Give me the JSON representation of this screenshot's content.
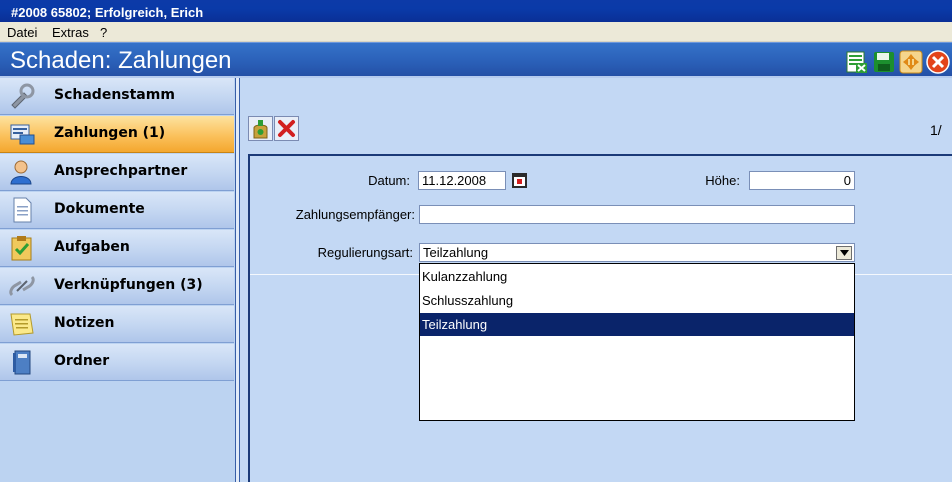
{
  "window": {
    "title": "#2008 65802; Erfolgreich, Erich"
  },
  "menu": {
    "items": [
      {
        "label": "Datei"
      },
      {
        "label": "Extras"
      },
      {
        "label": "?"
      }
    ]
  },
  "header": {
    "title": "Schaden: Zahlungen",
    "buttons": [
      {
        "icon": "excel-export-icon",
        "color": "#2e9e35"
      },
      {
        "icon": "save-icon",
        "color": "#1c8f2e"
      },
      {
        "icon": "navigate-icon",
        "color": "#f2a31b"
      },
      {
        "icon": "close-icon",
        "color": "#e3441a"
      }
    ]
  },
  "sidebar": {
    "items": [
      {
        "label": "Schadenstamm",
        "icon": "wrench-icon",
        "active": false
      },
      {
        "label": "Zahlungen (1)",
        "icon": "payment-icon",
        "active": true
      },
      {
        "label": "Ansprechpartner",
        "icon": "person-icon",
        "active": false
      },
      {
        "label": "Dokumente",
        "icon": "document-icon",
        "active": false
      },
      {
        "label": "Aufgaben",
        "icon": "task-icon",
        "active": false
      },
      {
        "label": "Verknüpfungen (3)",
        "icon": "link-icon",
        "active": false
      },
      {
        "label": "Notizen",
        "icon": "notes-icon",
        "active": false
      },
      {
        "label": "Ordner",
        "icon": "folder-icon",
        "active": false
      }
    ]
  },
  "toolbar": {
    "add_icon": "add-payment-icon",
    "delete_icon": "delete-icon",
    "page_counter": "1/"
  },
  "form": {
    "datum_label": "Datum:",
    "datum_value": "11.12.2008",
    "hoehe_label": "Höhe:",
    "hoehe_value": "0",
    "empfaenger_label": "Zahlungsempfänger:",
    "empfaenger_value": "",
    "regulierungsart_label": "Regulierungsart:",
    "regulierungsart_value": "Teilzahlung",
    "regulierungsart_options": [
      {
        "label": "Kulanzzahlung",
        "selected": false
      },
      {
        "label": "Schlusszahlung",
        "selected": false
      },
      {
        "label": "Teilzahlung",
        "selected": true
      }
    ]
  },
  "colors": {
    "titlebar": "#0a3aa8",
    "header": "#2a5fb7",
    "active_nav": "#fbc15c",
    "selection": "#0a246a"
  }
}
